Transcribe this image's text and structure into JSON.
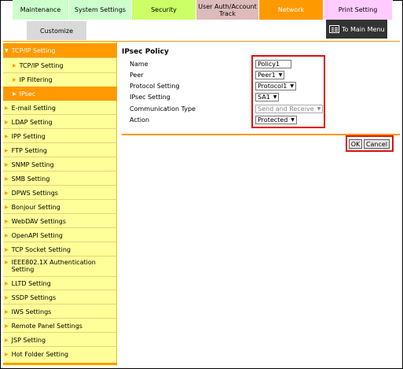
{
  "tabs": {
    "maintenance": "Maintenance",
    "system_settings": "System Settings",
    "security": "Security",
    "user_auth": "User Auth/Account Track",
    "network": "Network",
    "print_setting": "Print Setting"
  },
  "customize": "Customize",
  "to_main_menu": "To Main Menu",
  "sidebar": {
    "top": "TCP/IP Setting",
    "subs": [
      "TCP/IP Setting",
      "IP Filtering",
      "IPsec"
    ],
    "items": [
      "E-mail Setting",
      "LDAP Setting",
      "IPP Setting",
      "FTP Setting",
      "SNMP Setting",
      "SMB Setting",
      "DPWS Settings",
      "Bonjour Setting",
      "WebDAV Settings",
      "OpenAPI Setting",
      "TCP Socket Setting",
      "IEEE802.1X Authentication Setting",
      "LLTD Setting",
      "SSDP Settings",
      "IWS Settings",
      "Remote Panel Settings",
      "JSP Setting",
      "Hot Folder Setting"
    ]
  },
  "panel": {
    "title": "IPsec Policy",
    "labels": [
      "Name",
      "Peer",
      "Protocol Setting",
      "IPsec Setting",
      "Communication Type",
      "Action"
    ],
    "name_value": "Policy1",
    "peer_value": "Peer1",
    "protocol_value": "Protocol1",
    "ipsec_value": "SA1",
    "comm_type_value": "Send and Receive",
    "action_value": "Protected"
  },
  "buttons": {
    "ok": "OK",
    "cancel": "Cancel"
  },
  "colors": {
    "accent": "#ff9900",
    "sidebar_bg": "#ffff99",
    "highlight": "#e01010"
  }
}
